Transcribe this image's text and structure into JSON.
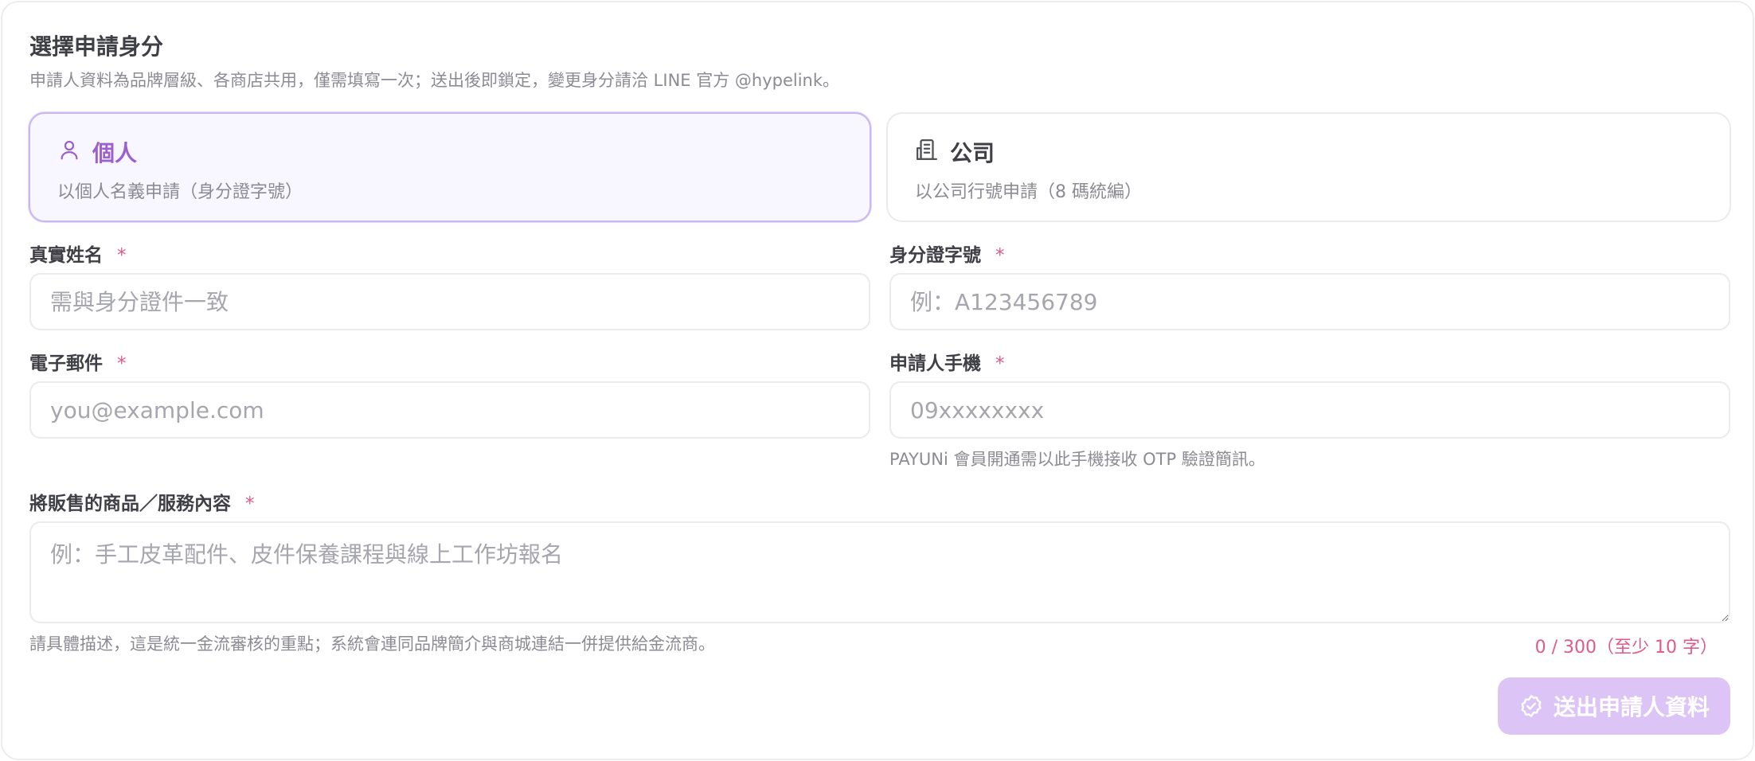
{
  "section": {
    "title": "選擇申請身分",
    "subtitle": "申請人資料為品牌層級、各商店共用，僅需填寫一次；送出後即鎖定，變更身分請洽 LINE 官方 @hypelink。"
  },
  "identity_options": [
    {
      "title": "個人",
      "description": "以個人名義申請（身分證字號）",
      "icon": "person-icon",
      "selected": true
    },
    {
      "title": "公司",
      "description": "以公司行號申請（8 碼統編）",
      "icon": "building-icon",
      "selected": false
    }
  ],
  "fields": {
    "name": {
      "label": "真實姓名",
      "required_mark": "*",
      "placeholder": "需與身分證件一致",
      "value": ""
    },
    "id_number": {
      "label": "身分證字號",
      "required_mark": "*",
      "placeholder": "例：A123456789",
      "value": ""
    },
    "email": {
      "label": "電子郵件",
      "required_mark": "*",
      "placeholder": "you@example.com",
      "value": ""
    },
    "phone": {
      "label": "申請人手機",
      "required_mark": "*",
      "placeholder": "09xxxxxxxx",
      "value": "",
      "help": "PAYUNi 會員開通需以此手機接收 OTP 驗證簡訊。"
    },
    "products": {
      "label": "將販售的商品／服務內容",
      "required_mark": "*",
      "placeholder": "例：手工皮革配件、皮件保養課程與線上工作坊報名",
      "value": "",
      "help": "請具體描述，這是統一金流審核的重點；系統會連同品牌簡介與商城連結一併提供給金流商。",
      "counter": "0 / 300（至少 10 字）"
    }
  },
  "submit": {
    "label": "送出申請人資料",
    "icon": "badge-check-icon",
    "enabled": false
  },
  "colors": {
    "accent": "#9b5fd0",
    "required": "#e05a86",
    "submit_disabled_bg": "#dcc4f7",
    "selected_card_bg": "#f8f6fe",
    "selected_card_border": "#c8b6f5"
  }
}
